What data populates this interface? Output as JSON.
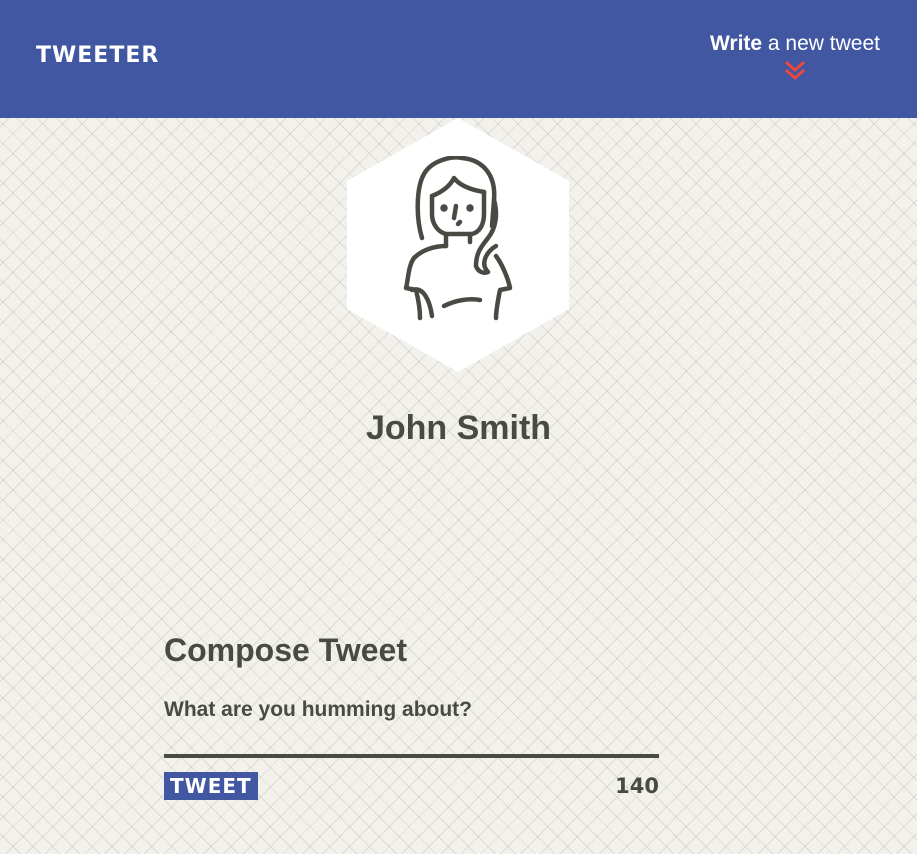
{
  "nav": {
    "brand": "TWEETER",
    "compose_toggle": {
      "bold": "Write",
      "rest": "a new tweet",
      "icon": "double-chevron-down-icon"
    }
  },
  "profile": {
    "avatar_icon": "person-avatar-icon",
    "name": "John Smith"
  },
  "composer": {
    "title": "Compose Tweet",
    "placeholder": "What are you humming about?",
    "submit_label": "TWEET",
    "counter": "140"
  },
  "colors": {
    "nav_bg": "#4157a2",
    "accent_red": "#e8483e",
    "text": "#4a4a44",
    "page_bg": "#f3f1ec"
  }
}
